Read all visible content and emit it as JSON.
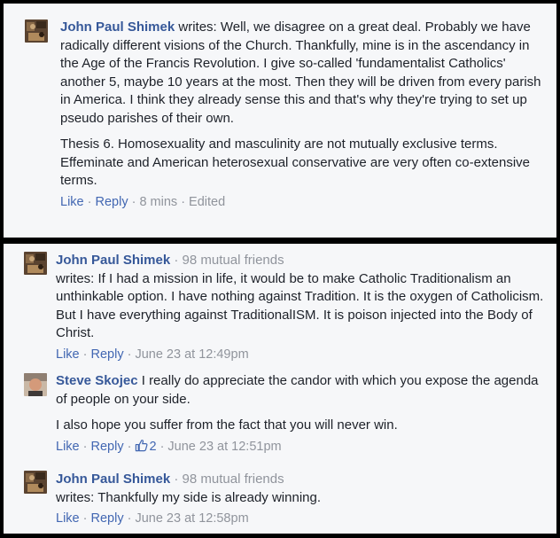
{
  "top": {
    "name": "John Paul Shimek",
    "text": " writes: Well, we disagree on a great deal. Probably we have radically different visions of the Church. Thankfully, mine is in the ascendancy in the Age of the Francis Revolution. I give so-called 'fundamentalist Catholics' another 5, maybe 10 years at the most. Then they will be driven from every parish in America. I think they already sense this and that's why they're trying to set up pseudo parishes of their own.",
    "text2": "Thesis 6. Homosexuality and masculinity are not mutually exclusive terms. Effeminate and American heterosexual conservative are very often co-extensive terms.",
    "like": "Like",
    "sep1": " · ",
    "reply": "Reply",
    "time": " · 8 mins · Edited"
  },
  "bottom": {
    "c1": {
      "name": "John Paul Shimek",
      "mutual": " · 98 mutual friends",
      "text": "writes: If I had a mission in life, it would be to make Catholic Traditionalism an unthinkable option. I have nothing against Tradition. It is the oxygen of Catholicism. But I have everything against TraditionalISM. It is poison injected into the Body of Christ.",
      "like": "Like",
      "sep1": " · ",
      "reply": "Reply",
      "time": " · June 23 at 12:49pm"
    },
    "c2": {
      "name": "Steve Skojec",
      "text": " I really do appreciate the candor with which you expose the agenda of people on your side.",
      "text2": "I also hope you suffer from the fact that you will never win.",
      "like": "Like",
      "sep1": " · ",
      "reply": "Reply",
      "sep2": " · ",
      "likes": "2",
      "time": " · June 23 at 12:51pm"
    },
    "c3": {
      "name": "John Paul Shimek",
      "mutual": " · 98 mutual friends",
      "text": "writes: Thankfully my side is already winning.",
      "like": "Like",
      "sep1": " · ",
      "reply": "Reply",
      "time": " · June 23 at 12:58pm"
    }
  },
  "colors": {
    "name": "#365899",
    "link": "#4267b2",
    "meta": "#90949c",
    "text": "#1d2129",
    "panel": "#f6f7f9",
    "frame": "#000000"
  },
  "icons": {
    "like_count": "thumbs-up-icon"
  }
}
